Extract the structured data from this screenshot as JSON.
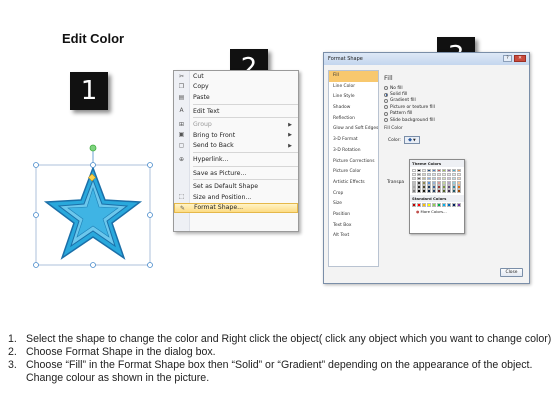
{
  "title": "Edit Color",
  "badges": [
    "1",
    "2",
    "3"
  ],
  "context_menu": {
    "items": [
      {
        "label": "Cut",
        "icon": "scissors-icon",
        "glyph": "✂",
        "disabled": false,
        "submenu": false
      },
      {
        "label": "Copy",
        "icon": "copy-icon",
        "glyph": "❐",
        "disabled": false,
        "submenu": false
      },
      {
        "label": "Paste",
        "icon": "paste-icon",
        "glyph": "▤",
        "disabled": false,
        "submenu": false
      },
      {
        "sep": true
      },
      {
        "label": "Edit Text",
        "icon": "edit-text-icon",
        "glyph": "A",
        "disabled": false,
        "submenu": false
      },
      {
        "sep": true
      },
      {
        "label": "Group",
        "icon": "group-icon",
        "glyph": "⊞",
        "disabled": true,
        "submenu": true
      },
      {
        "label": "Bring to Front",
        "icon": "bring-front-icon",
        "glyph": "▣",
        "disabled": false,
        "submenu": true
      },
      {
        "label": "Send to Back",
        "icon": "send-back-icon",
        "glyph": "▢",
        "disabled": false,
        "submenu": true
      },
      {
        "sep": true
      },
      {
        "label": "Hyperlink...",
        "icon": "hyperlink-icon",
        "glyph": "⊕",
        "disabled": false,
        "submenu": false
      },
      {
        "sep": true
      },
      {
        "label": "Save as Picture...",
        "icon": "",
        "glyph": "",
        "disabled": false,
        "submenu": false
      },
      {
        "sep": true
      },
      {
        "label": "Set as Default Shape",
        "icon": "",
        "glyph": "",
        "disabled": false,
        "submenu": false
      },
      {
        "label": "Size and Position...",
        "icon": "size-icon",
        "glyph": "⬚",
        "disabled": false,
        "submenu": false
      },
      {
        "label": "Format Shape...",
        "icon": "format-shape-icon",
        "glyph": "✎",
        "disabled": false,
        "submenu": false,
        "active": true
      }
    ]
  },
  "dialog": {
    "title": "Format Shape",
    "nav": [
      "Fill",
      "Line Color",
      "Line Style",
      "Shadow",
      "Reflection",
      "Glow and Soft Edges",
      "3-D Format",
      "3-D Rotation",
      "Picture Corrections",
      "Picture Color",
      "Artistic Effects",
      "Crop",
      "Size",
      "Position",
      "Text Box",
      "Alt Text"
    ],
    "selected_nav": "Fill",
    "pane_heading": "Fill",
    "options": [
      {
        "label": "No fill",
        "checked": false
      },
      {
        "label": "Solid fill",
        "checked": true
      },
      {
        "label": "Gradient fill",
        "checked": false
      },
      {
        "label": "Picture or texture fill",
        "checked": false
      },
      {
        "label": "Pattern fill",
        "checked": false
      },
      {
        "label": "Slide background fill",
        "checked": false
      }
    ],
    "fill_color_label": "Fill Color",
    "color_label": "Color:",
    "transparency_label": "Transpa",
    "close_label": "Close",
    "palette": {
      "theme_heading": "Theme Colors",
      "standard_heading": "Standard Colors",
      "more_label": "More Colors...",
      "theme_rows": [
        [
          "#ffffff",
          "#000000",
          "#eeece1",
          "#1f497d",
          "#4f81bd",
          "#c0504d",
          "#9bbb59",
          "#8064a2",
          "#4bacc6",
          "#f79646"
        ],
        [
          "#f2f2f2",
          "#7f7f7f",
          "#ddd9c3",
          "#c6d9f0",
          "#dbe5f1",
          "#f2dcdb",
          "#ebf1dd",
          "#e5e0ec",
          "#dbeef3",
          "#fdeada"
        ],
        [
          "#d8d8d8",
          "#595959",
          "#c4bd97",
          "#8db3e2",
          "#b8cce4",
          "#e5b9b7",
          "#d7e3bc",
          "#ccc1d9",
          "#b7dde8",
          "#fbd5b5"
        ],
        [
          "#bfbfbf",
          "#3f3f3f",
          "#938953",
          "#548dd4",
          "#95b3d7",
          "#d99694",
          "#c3d69b",
          "#b2a2c7",
          "#92cddc",
          "#fac08f"
        ],
        [
          "#a5a5a5",
          "#262626",
          "#494429",
          "#17365d",
          "#366092",
          "#953734",
          "#76923c",
          "#5f497a",
          "#31859b",
          "#e36c09"
        ],
        [
          "#7f7f7f",
          "#0c0c0c",
          "#1d1b10",
          "#0f243e",
          "#244061",
          "#632423",
          "#4f6128",
          "#3f3151",
          "#205867",
          "#974806"
        ]
      ],
      "standard_row": [
        "#c00000",
        "#ff0000",
        "#ffc000",
        "#ffff00",
        "#92d050",
        "#00b050",
        "#00b0f0",
        "#0070c0",
        "#002060",
        "#7030a0"
      ]
    }
  },
  "instructions": [
    {
      "num": "1.",
      "text": "Select the shape to change the color and Right click the object( click any object which you want to change color)"
    },
    {
      "num": "2.",
      "text": "Choose Format Shape in the dialog box."
    },
    {
      "num": "3.",
      "text": "Choose “Fill” in the Format Shape box then “Solid” or “Gradient” depending on the appearance of the object. Change colour as shown in the picture."
    }
  ],
  "colors": {
    "star_fill": "#29a8dc",
    "star_inner": "#6cc7ec",
    "star_stroke": "#1b6fa8",
    "handle": "#4a8ccc",
    "rotate_handle": "#3fae3f"
  }
}
